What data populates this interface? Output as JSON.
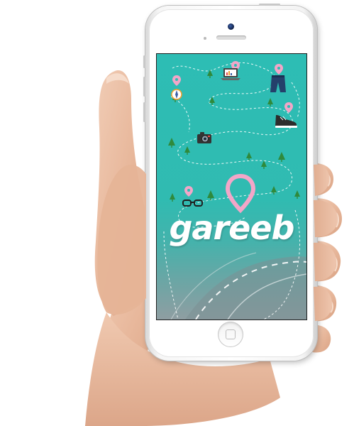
{
  "app": {
    "logo_text": "gareeb"
  },
  "icons": {
    "pin": "map-pin-icon",
    "camera": "camera-icon",
    "laptop": "laptop-icon",
    "jeans": "jeans-icon",
    "shoe": "sneaker-icon",
    "glasses": "glasses-icon",
    "compass": "compass-icon",
    "tree": "tree-icon"
  },
  "colors": {
    "screen_teal": "#2dbdb4",
    "pin_pink": "#f3a6c8",
    "tree_green": "#2f8a3c",
    "logo_white": "#ffffff"
  }
}
